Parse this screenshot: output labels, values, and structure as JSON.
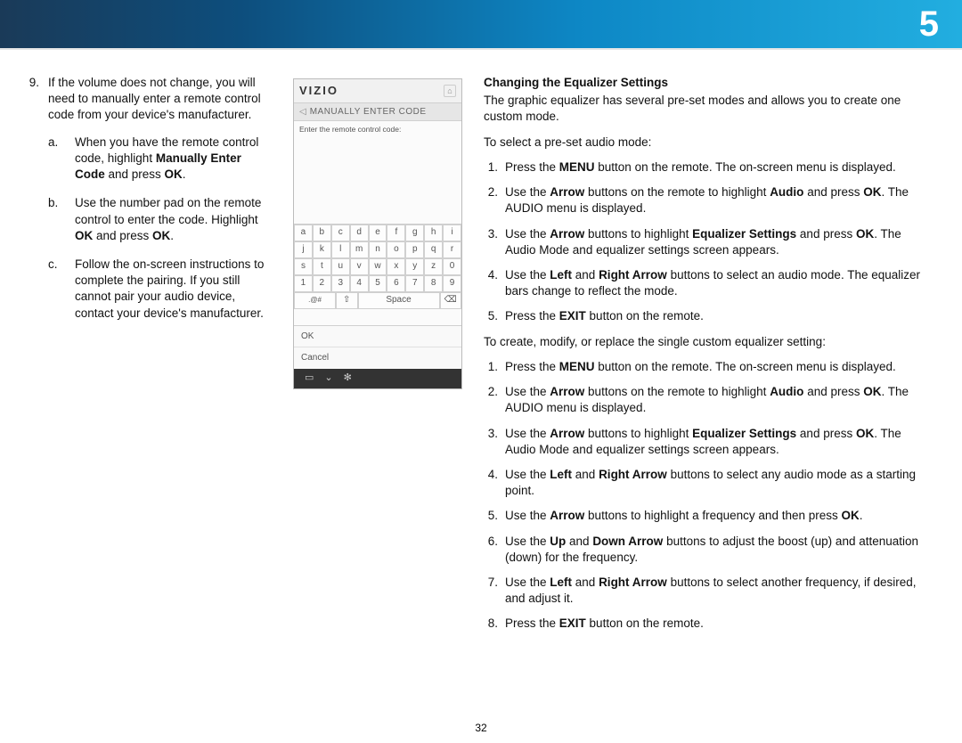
{
  "banner": {
    "chapter": "5"
  },
  "page_number": "32",
  "left": {
    "item_marker": "9.",
    "item_text": "If the volume does not change, you will need to manually enter a remote control code from your device's manufacturer.",
    "subs": [
      {
        "m": "a.",
        "pre": "When you have the remote control code, highlight ",
        "bold1": "Manually Enter Code",
        "mid": " and press ",
        "bold2": "OK",
        "post": "."
      },
      {
        "m": "b.",
        "pre": "Use the number pad on the remote control to enter the code. Highlight ",
        "bold1": "OK",
        "mid": " and press ",
        "bold2": "OK",
        "post": "."
      },
      {
        "m": "c.",
        "pre": "Follow the on-screen instructions to complete the pairing. If you still cannot pair your audio device, contact your device's manufacturer.",
        "bold1": "",
        "mid": "",
        "bold2": "",
        "post": ""
      }
    ]
  },
  "shot": {
    "brand": "VIZIO",
    "title": "MANUALLY ENTER CODE",
    "hint": "Enter the remote control code:",
    "rows": [
      [
        "a",
        "b",
        "c",
        "d",
        "e",
        "f",
        "g",
        "h",
        "i"
      ],
      [
        "j",
        "k",
        "l",
        "m",
        "n",
        "o",
        "p",
        "q",
        "r"
      ],
      [
        "s",
        "t",
        "u",
        "v",
        "w",
        "x",
        "y",
        "z",
        "0"
      ],
      [
        "1",
        "2",
        "3",
        "4",
        "5",
        "6",
        "7",
        "8",
        "9"
      ]
    ],
    "sym": ".@#",
    "shift": "⇧",
    "space": "Space",
    "del": "⌫",
    "ok": "OK",
    "cancel": "Cancel"
  },
  "right": {
    "heading": "Changing the Equalizer Settings",
    "intro": "The graphic equalizer has several pre-set modes and allows you to create one custom mode.",
    "lead1": "To select a pre-set audio mode:",
    "steps1": [
      {
        "n": "1.",
        "html": "Press the <b>MENU</b> button on the remote. The on-screen menu is displayed."
      },
      {
        "n": "2.",
        "html": "Use the <b>Arrow</b> buttons on the remote to highlight <b>Audio</b> and press <b>OK</b>. The AUDIO menu is displayed."
      },
      {
        "n": "3.",
        "html": "Use the <b>Arrow</b> buttons to highlight <b>Equalizer Settings</b> and press <b>OK</b>. The Audio Mode and equalizer settings screen appears."
      },
      {
        "n": "4.",
        "html": "Use the <b>Left</b> and <b>Right Arrow</b> buttons to select an audio mode. The equalizer bars change to reflect the mode."
      },
      {
        "n": "5.",
        "html": "Press the <b>EXIT</b> button on the remote."
      }
    ],
    "lead2": "To create, modify, or replace the single custom equalizer setting:",
    "steps2": [
      {
        "n": "1.",
        "html": "Press the <b>MENU</b> button on the remote. The on-screen menu is displayed."
      },
      {
        "n": "2.",
        "html": "Use the <b>Arrow</b> buttons on the remote to highlight <b>Audio</b> and press <b>OK</b>. The AUDIO menu is displayed."
      },
      {
        "n": "3.",
        "html": "Use the <b>Arrow</b> buttons to highlight <b>Equalizer Settings</b> and press <b>OK</b>. The Audio Mode and equalizer settings screen appears."
      },
      {
        "n": "4.",
        "html": "Use the <b>Left</b> and <b>Right Arrow</b> buttons to select any audio mode as a starting point."
      },
      {
        "n": "5.",
        "html": "Use the <b>Arrow</b> buttons to highlight a frequency and then press <b>OK</b>."
      },
      {
        "n": "6.",
        "html": "Use the <b>Up</b> and <b>Down Arrow</b> buttons to adjust the boost (up) and attenuation (down) for the frequency."
      },
      {
        "n": "7.",
        "html": "Use the <b>Left</b> and <b>Right Arrow</b> buttons to select another frequency, if desired, and adjust it."
      },
      {
        "n": "8.",
        "html": "Press the <b>EXIT</b> button on the remote."
      }
    ]
  }
}
